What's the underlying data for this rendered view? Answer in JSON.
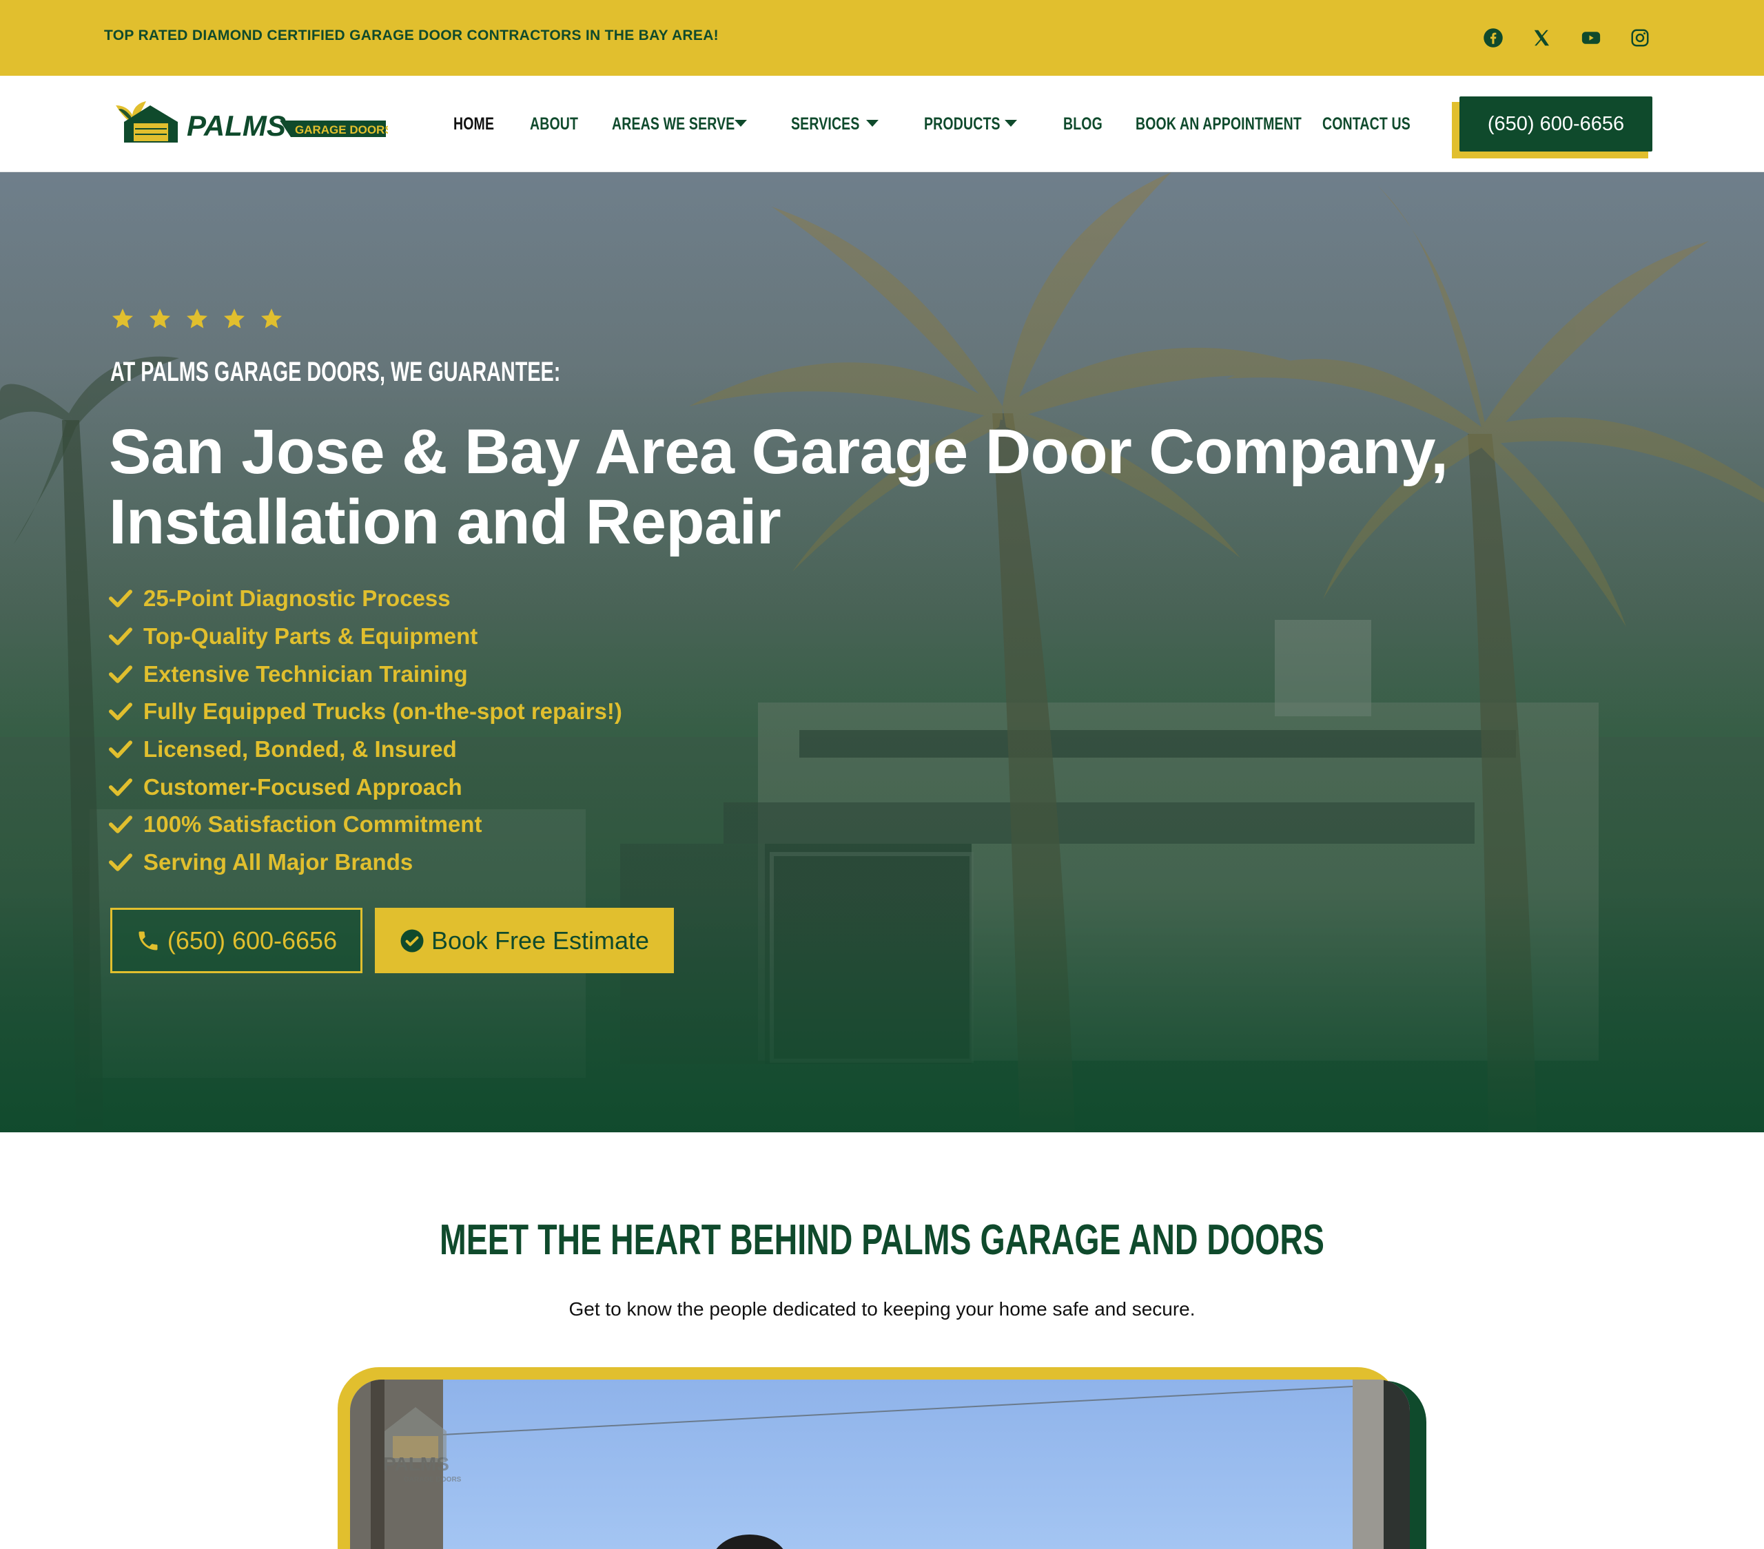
{
  "colors": {
    "brand_green": "#0F4A2C",
    "brand_yellow": "#E1BF2E"
  },
  "topbar": {
    "tagline": "TOP RATED DIAMOND CERTIFIED GARAGE DOOR CONTRACTORS IN THE BAY AREA!",
    "social": [
      "facebook-icon",
      "x-icon",
      "youtube-icon",
      "instagram-icon"
    ]
  },
  "header": {
    "logo": {
      "brand": "PALMS",
      "sub": "GARAGE DOORS"
    },
    "nav": {
      "home": "HOME",
      "about": "ABOUT",
      "areas": "AREAS WE SERVE",
      "services": "SERVICES",
      "products": "PRODUCTS",
      "blog": "BLOG",
      "book": "BOOK AN APPOINTMENT",
      "contact": "CONTACT US"
    },
    "phone": "(650) 600-6656"
  },
  "hero": {
    "rating_stars": 5,
    "eyebrow": "AT PALMS GARAGE DOORS, WE GUARANTEE:",
    "title_line1": "San Jose & Bay Area Garage Door Company,",
    "title_line2": "Installation and Repair",
    "features": [
      "25-Point Diagnostic Process",
      "Top-Quality Parts & Equipment",
      "Extensive Technician Training",
      "Fully Equipped Trucks (on-the-spot repairs!)",
      "Licensed, Bonded, & Insured",
      "Customer-Focused Approach",
      "100% Satisfaction Commitment",
      "Serving All Major Brands"
    ],
    "call_button": "(650) 600-6656",
    "book_button": "Book Free Estimate"
  },
  "team": {
    "title": "MEET THE HEART BEHIND PALMS GARAGE AND DOORS",
    "subtitle": "Get to know the people dedicated to keeping your home safe and secure.",
    "video_watermark": {
      "brand": "PALMS",
      "sub": "GARAGE DOORS"
    }
  }
}
